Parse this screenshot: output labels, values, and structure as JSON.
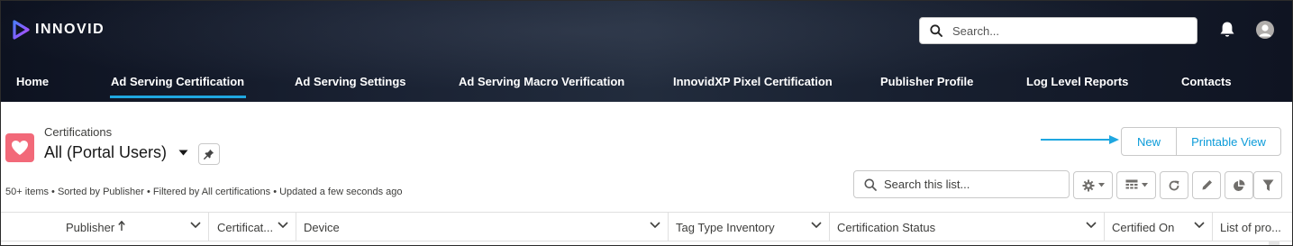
{
  "app": {
    "logo_text": "INNOVID",
    "search_placeholder": "Search...",
    "brand_accent": "#1fa7e0"
  },
  "nav": {
    "items": [
      {
        "label": "Home"
      },
      {
        "label": "Ad Serving Certification",
        "active": true
      },
      {
        "label": "Ad Serving Settings"
      },
      {
        "label": "Ad Serving Macro Verification"
      },
      {
        "label": "InnovidXP Pixel Certification"
      },
      {
        "label": "Publisher Profile"
      },
      {
        "label": "Log Level Reports"
      },
      {
        "label": "Contacts"
      }
    ]
  },
  "list_view": {
    "object_label": "Certifications",
    "view_name": "All (Portal Users)",
    "meta": "50+ items • Sorted by Publisher • Filtered by All certifications • Updated a few seconds ago",
    "search_placeholder": "Search this list...",
    "icon_color": "#f26979",
    "buttons": {
      "new": "New",
      "printable": "Printable View"
    }
  },
  "table": {
    "columns": [
      {
        "label": "Publisher",
        "sorted": "asc"
      },
      {
        "label": "Certificat..."
      },
      {
        "label": "Device"
      },
      {
        "label": "Tag Type Inventory"
      },
      {
        "label": "Certification Status"
      },
      {
        "label": "Certified On"
      },
      {
        "label": "List of pro..."
      }
    ]
  }
}
